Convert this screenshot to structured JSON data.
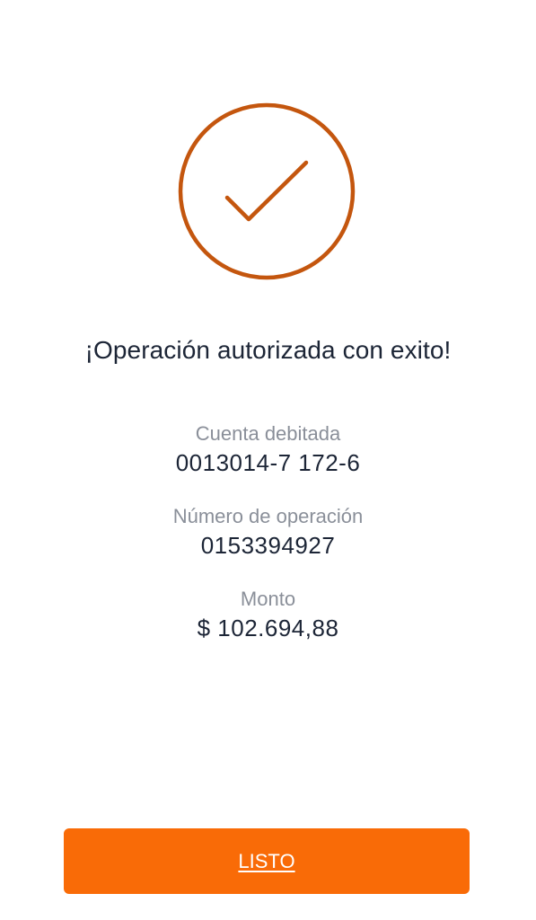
{
  "title": "¡Operación autorizada con exito!",
  "details": [
    {
      "label": "Cuenta debitada",
      "value": "0013014-7 172-6"
    },
    {
      "label": "Número de operación",
      "value": "0153394927"
    },
    {
      "label": "Monto",
      "value": "$ 102.694,88"
    }
  ],
  "done_button": {
    "label": "LISTO"
  },
  "icon": {
    "name": "checkmark-circle-icon",
    "color": "#c4560e"
  },
  "colors": {
    "accent": "#f96b07",
    "text_primary": "#1c2536",
    "text_secondary": "#8a8f99",
    "background": "#ffffff"
  }
}
